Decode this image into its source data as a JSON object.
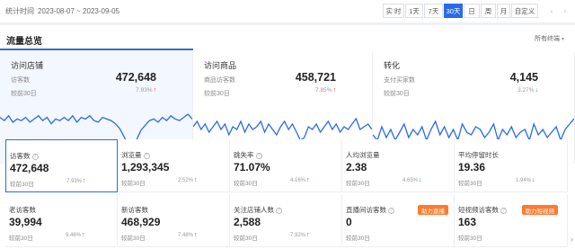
{
  "header": {
    "range_label": "统计时间",
    "range_value": "2023-08-07 ~ 2023-09-05",
    "periods": [
      {
        "label": "实 时",
        "active": false
      },
      {
        "label": "1天",
        "active": false
      },
      {
        "label": "7天",
        "active": false
      },
      {
        "label": "30天",
        "active": true
      },
      {
        "label": "日",
        "active": false
      },
      {
        "label": "周",
        "active": false
      },
      {
        "label": "月",
        "active": false
      },
      {
        "label": "自定义",
        "active": false
      }
    ],
    "prev_glyph": "‹",
    "next_glyph": "›"
  },
  "panel": {
    "title": "流量总览",
    "filter_label": "所有终端",
    "cards": [
      {
        "title": "访问店铺",
        "label": "访客数",
        "value": "472,648",
        "compare": "较前30日",
        "pct": "7.93%",
        "dir": "up",
        "trend": [
          52,
          50,
          53,
          49,
          51,
          50,
          52,
          49,
          51,
          53,
          50,
          52,
          48,
          51,
          50,
          52,
          50,
          53,
          49,
          52,
          51,
          53,
          50,
          49,
          52,
          51,
          50,
          48,
          45,
          40,
          35,
          32,
          38,
          44,
          47,
          50,
          51,
          49,
          52,
          50,
          53,
          51,
          50,
          52,
          54,
          51
        ]
      },
      {
        "title": "访问商品",
        "label": "商品访客数",
        "value": "458,721",
        "compare": "较前30日",
        "pct": "7.85%",
        "dir": "up",
        "trend": [
          51,
          53,
          50,
          52,
          49,
          51,
          53,
          50,
          52,
          48,
          51,
          50,
          53,
          49,
          52,
          50,
          51,
          53,
          49,
          52,
          50,
          48,
          51,
          53,
          50,
          52,
          49,
          46,
          47,
          51,
          50,
          52,
          49,
          51,
          53,
          50,
          52,
          49,
          51,
          50,
          52,
          54,
          50,
          51,
          52,
          50
        ]
      },
      {
        "title": "转化",
        "label": "支付买家数",
        "value": "4,145",
        "compare": "较前30日",
        "pct": "3.27%",
        "dir": "down",
        "trend": [
          42,
          40,
          45,
          41,
          44,
          40,
          43,
          46,
          41,
          44,
          42,
          45,
          40,
          44,
          47,
          42,
          45,
          41,
          44,
          40,
          46,
          43,
          42,
          45,
          44,
          41,
          43,
          46,
          40,
          44,
          42,
          45,
          41,
          43,
          44,
          40,
          46,
          42,
          44,
          41,
          43,
          45,
          40,
          44,
          46,
          48
        ]
      }
    ],
    "metrics": [
      {
        "label": "访客数",
        "help": true,
        "value": "472,648",
        "compare": "较前30日",
        "pct": "7.93%",
        "dir": "up",
        "selected": true
      },
      {
        "label": "浏览量",
        "help": true,
        "value": "1,293,345",
        "compare": "较前30日",
        "pct": "2.52%",
        "dir": "up"
      },
      {
        "label": "跳失率",
        "help": true,
        "value": "71.07%",
        "compare": "较前30日",
        "pct": "4.16%",
        "dir": "up"
      },
      {
        "label": "人均浏览量",
        "help": false,
        "value": "2.38",
        "compare": "较前30日",
        "pct": "4.65%",
        "dir": "down"
      },
      {
        "label": "平均停留时长",
        "help": false,
        "value": "19.36",
        "compare": "较前30日",
        "pct": "1.94%",
        "dir": "down"
      },
      {
        "label": "老访客数",
        "help": false,
        "value": "39,994",
        "compare": "较前30日",
        "pct": "9.46%",
        "dir": "up"
      },
      {
        "label": "新访客数",
        "help": false,
        "value": "468,929",
        "compare": "较前30日",
        "pct": "7.48%",
        "dir": "up"
      },
      {
        "label": "关注店铺人数",
        "help": true,
        "value": "2,588",
        "compare": "较前30日",
        "pct": "7.92%",
        "dir": "up"
      },
      {
        "label": "直播间访客数",
        "help": true,
        "value": "0",
        "compare": "较前30日",
        "pct": "",
        "dir": "",
        "badge": "助力直播"
      },
      {
        "label": "短视频访客数",
        "help": true,
        "value": "163",
        "compare": "较前30日",
        "pct": "",
        "dir": "",
        "badge": "助力短视频"
      }
    ],
    "more_glyph": "›"
  },
  "colors": {
    "accent": "#2a6ae9",
    "up": "#e02e24",
    "down": "#21a36a",
    "badge": "#ff7a2f"
  },
  "icons": {
    "arrow_up": "up-arrow-icon",
    "arrow_down": "down-arrow-icon",
    "help": "question-icon",
    "dropdown": "chevron-down-icon"
  }
}
